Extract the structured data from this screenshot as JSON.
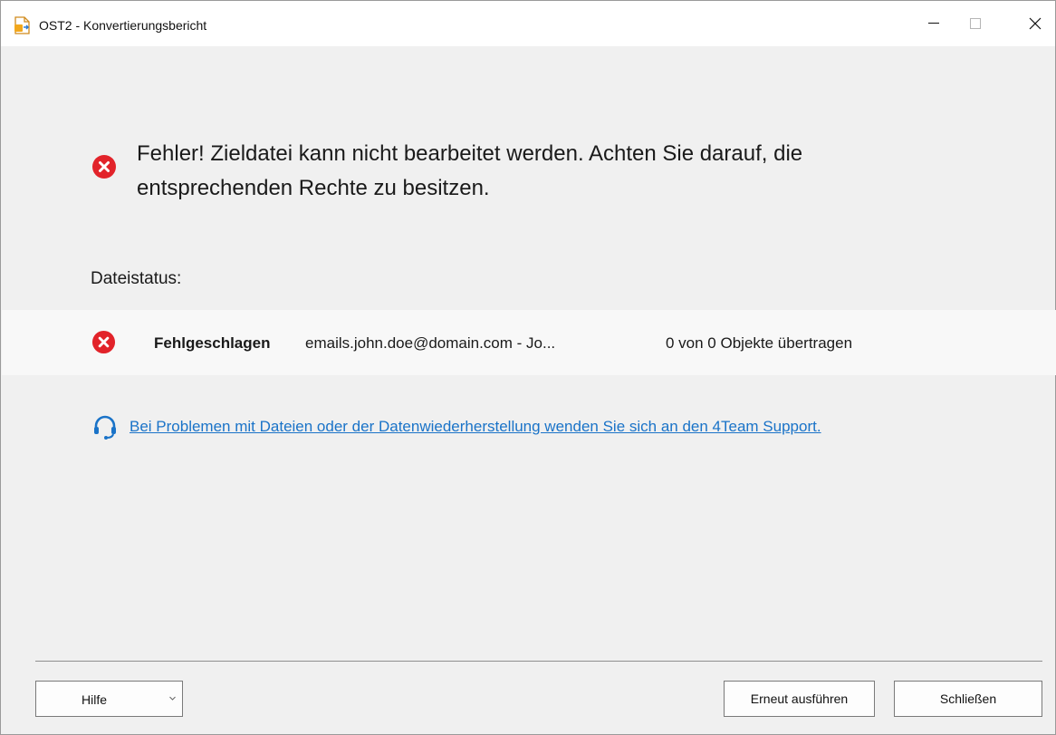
{
  "window": {
    "title": "OST2 - Konvertierungsbericht"
  },
  "error": {
    "icon": "error-circle-icon",
    "message_line1": "Fehler! Zieldatei kann nicht bearbeitet werden. Achten Sie darauf, die",
    "message_line2": "entsprechenden Rechte zu besitzen."
  },
  "status": {
    "label": "Dateistatus:",
    "rows": [
      {
        "icon": "error-circle-icon",
        "state": "Fehlgeschlagen",
        "file": "emails.john.doe@domain.com - Jo...",
        "count": "0 von 0 Objekte übertragen"
      }
    ]
  },
  "support": {
    "icon": "headset-icon",
    "link_text": "Bei Problemen mit Dateien oder der Datenwiederherstellung wenden Sie sich an den 4Team Support."
  },
  "buttons": {
    "help": "Hilfe",
    "retry": "Erneut ausführen",
    "close": "Schließen"
  },
  "colors": {
    "error": "#e2232a",
    "link": "#1a73c8",
    "background": "#f0f0f0"
  }
}
